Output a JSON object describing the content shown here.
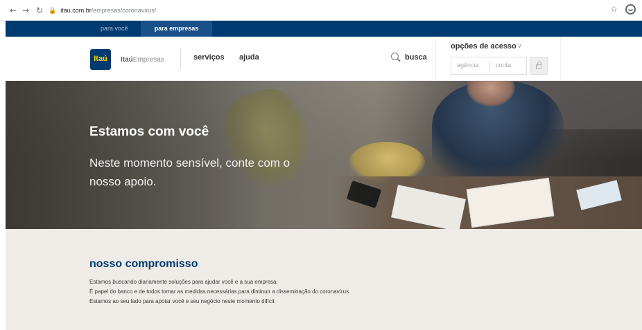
{
  "browser": {
    "url_host": "itau.com.br",
    "url_path": "/empresas/coronavirus/"
  },
  "segments": {
    "pessoa_fisica": "para você",
    "empresas": "para empresas"
  },
  "header": {
    "logo_text": "Itaú",
    "brand_bold": "Itaú",
    "brand_light": "Empresas",
    "menu_servicos": "serviços",
    "menu_ajuda": "ajuda",
    "search_label": "busca",
    "access_title": "opções de acesso",
    "agencia_placeholder": "agência",
    "conta_placeholder": "conta"
  },
  "hero": {
    "title": "Estamos com você",
    "subtitle": "Neste momento sensível, conte com o nosso apoio."
  },
  "commitment": {
    "title": "nosso compromisso",
    "lines": [
      "Estamos buscando diariamente soluções para ajudar você e a sua empresa.",
      "É papel do banco e de todos tomar as medidas necessárias para diminuir a disseminação do coronavírus.",
      "Estamos ao seu lado para apoiar você e seu negócio neste momento difícil."
    ]
  },
  "icons": {
    "back": "arrow-left-icon",
    "forward": "arrow-right-icon",
    "reload": "reload-icon",
    "lock": "lock-icon",
    "star": "star-icon",
    "profile": "profile-icon",
    "search": "search-icon",
    "chevron": "chevron-down-icon",
    "login_lock": "lock-icon"
  },
  "colors": {
    "brand_navy": "#003a70",
    "segment_active": "#19508a",
    "logo_yellow": "#ffd500",
    "commit_bg": "#efebe7"
  }
}
